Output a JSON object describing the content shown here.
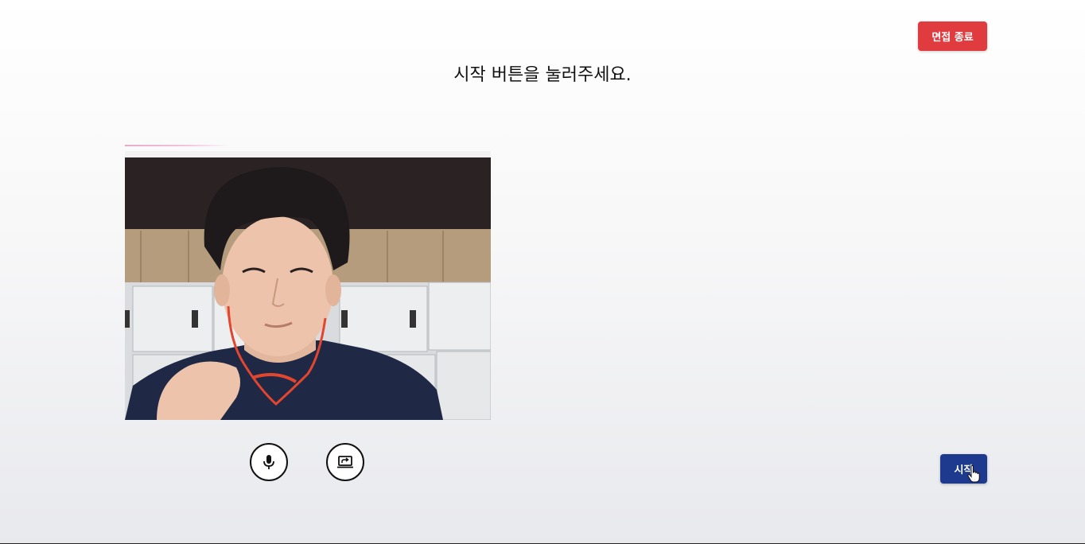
{
  "header": {
    "end_button_label": "면접 종료"
  },
  "main": {
    "prompt": "시작 버튼을 눌러주세요."
  },
  "controls": {
    "mic_icon": "microphone-icon",
    "screen_icon": "screen-share-icon"
  },
  "footer": {
    "start_button_label": "시작"
  },
  "colors": {
    "end_button": "#e03b3f",
    "start_button": "#1d3a8f",
    "background_top": "#ffffff",
    "background_bottom": "#e8e9ed"
  }
}
